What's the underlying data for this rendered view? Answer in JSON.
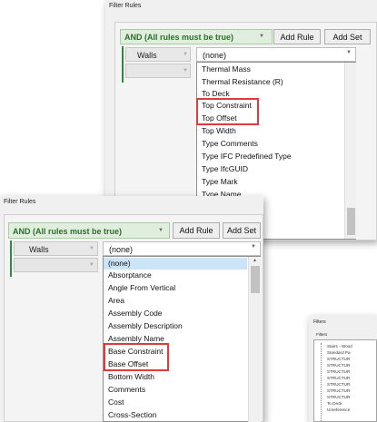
{
  "panel_top": {
    "title": "Filter Rules",
    "and_label": "AND (All rules must be true)",
    "add_rule": "Add Rule",
    "add_set": "Add Set",
    "category": "Walls",
    "field_value": "(none)",
    "items": [
      "Thermal Mass",
      "Thermal Resistance (R)",
      "To Deck",
      "Top Constraint",
      "Top Offset",
      "Top Width",
      "Type Comments",
      "Type IFC Predefined Type",
      "Type IfcGUID",
      "Type Mark",
      "Type Name"
    ]
  },
  "panel_bottom": {
    "title": "Filter Rules",
    "and_label": "AND (All rules must be true)",
    "add_rule": "Add Rule",
    "add_set": "Add Set",
    "category": "Walls",
    "field_value": "(none)",
    "items": [
      "(none)",
      "Absorptance",
      "Angle From Vertical",
      "Area",
      "Assembly Code",
      "Assembly Description",
      "Assembly Name",
      "Base Constraint",
      "Base Offset",
      "Bottom Width",
      "Comments",
      "Cost",
      "Cross-Section"
    ]
  },
  "panel_filters": {
    "title": "Filters",
    "subtitle": "Filters",
    "items": [
      "Stairs - Wood",
      "Standard Pa",
      "STRUCTUR",
      "STRUCTUR",
      "STRUCTUR",
      "STRUCTUR",
      "STRUCTUR",
      "STRUCTUR",
      "STRUCTUR",
      "To Deck",
      "Unreference"
    ]
  },
  "colors": {
    "highlight_box": "#e03a3a",
    "and_text": "#2d6e2a",
    "and_bg": "#dfeedd",
    "selection": "#cce4f7"
  }
}
